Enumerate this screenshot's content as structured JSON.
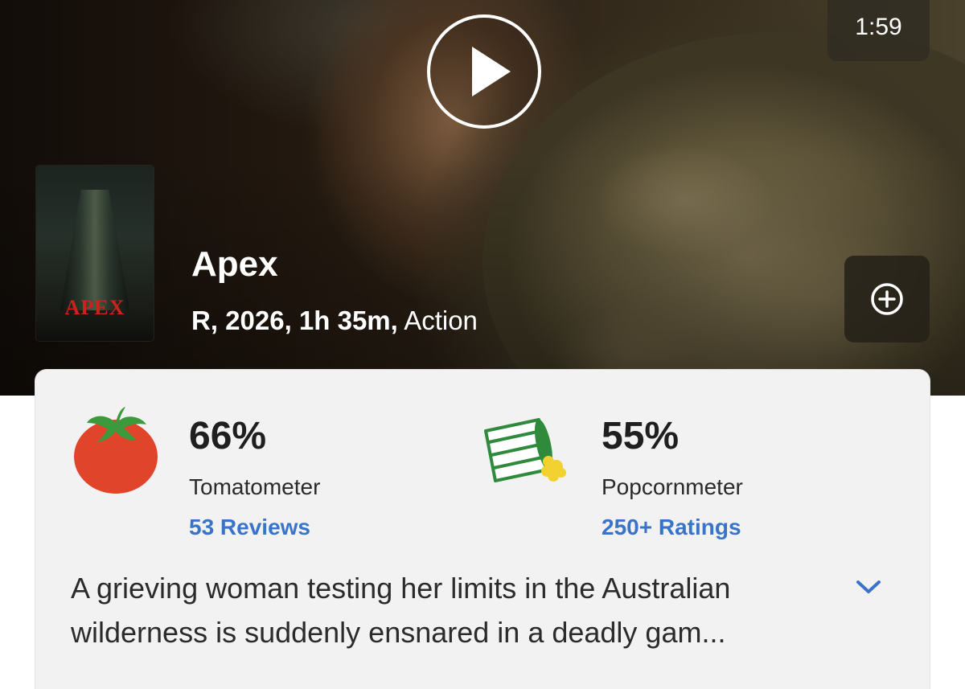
{
  "trailer": {
    "duration": "1:59"
  },
  "poster": {
    "title_text": "APEX"
  },
  "movie": {
    "title": "Apex",
    "meta": "R, 2026, 1h 35m,",
    "genre": "Action"
  },
  "scores": {
    "tomatometer": {
      "value": "66%",
      "label": "Tomatometer",
      "count": "53 Reviews"
    },
    "popcornmeter": {
      "value": "55%",
      "label": "Popcornmeter",
      "count": "250+ Ratings"
    }
  },
  "synopsis": "A grieving woman testing her limits in the Australian wilderness is suddenly ensnared in a deadly gam...",
  "colors": {
    "link": "#3a74c9",
    "tomato_red": "#e0442b",
    "tomato_stem": "#3c9a3c",
    "popcorn_green": "#2f8a3c",
    "popcorn_yellow": "#f2d230"
  },
  "icons": {
    "play": "play-icon",
    "add": "plus-circle-icon",
    "tomato": "tomato-icon",
    "popcorn": "spilled-popcorn-icon",
    "expand": "chevron-down-icon"
  }
}
